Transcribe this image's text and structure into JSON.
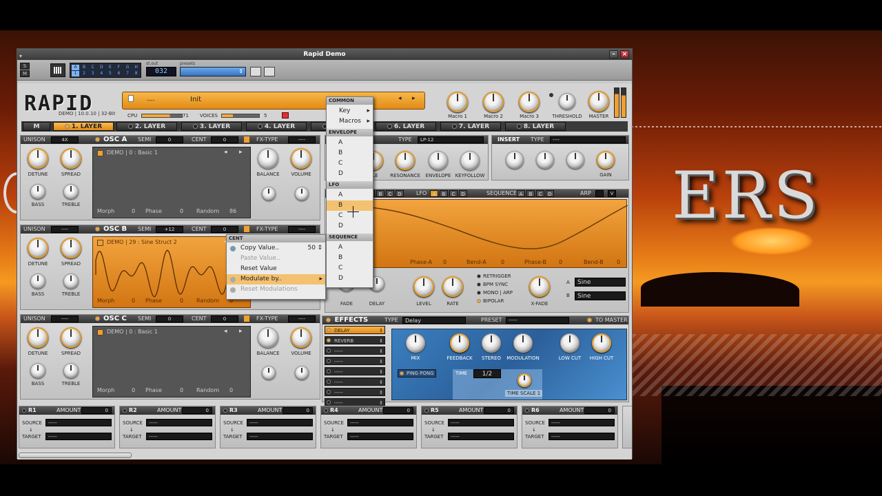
{
  "window": {
    "title": "Rapid Demo",
    "minimize": "–",
    "close": "×"
  },
  "toolbar": {
    "s_btn": "S",
    "m_btn": "M",
    "midi_grid": [
      "A",
      "B",
      "C",
      "D",
      "E",
      "F",
      "G",
      "H",
      "1",
      "2",
      "3",
      "4",
      "5",
      "6",
      "7",
      "8"
    ],
    "output_label": "st.out",
    "output_value": "032",
    "preset_label": "presets"
  },
  "header": {
    "logo": "RAPID",
    "version": "DEMO | 10.0.10 | 32-Bit",
    "preset_name": "Init",
    "preset_dash": "----",
    "cpu_label": "CPU",
    "cpu_value": "71",
    "voices_label": "VOICES",
    "voices_value": "5",
    "macros": [
      "Macro 1",
      "Macro 2",
      "Macro 3"
    ],
    "threshold": "THRESHOLD",
    "master": "MASTER"
  },
  "layers": [
    "M",
    "1. LAYER",
    "2. LAYER",
    "3. LAYER",
    "4. LAYER",
    "5. LAYER",
    "6. LAYER",
    "7. LAYER",
    "8. LAYER"
  ],
  "osc": [
    {
      "name": "OSC A",
      "unison": "UNISON",
      "unison_val": "4X",
      "semi": "SEMI",
      "semi_val": "0",
      "cent": "CENT",
      "cent_val": "0",
      "fx": "FX-TYPE",
      "fx_val": "----",
      "wave_title": "DEMO | 0 : Basic 1",
      "morph": "Morph",
      "morph_val": "0",
      "phase": "Phase",
      "phase_val": "0",
      "random": "Random",
      "random_val": "86"
    },
    {
      "name": "OSC B",
      "unison": "UNISON",
      "unison_val": "----",
      "semi": "SEMI",
      "semi_val": "+12",
      "cent": "CENT",
      "cent_val": "0",
      "fx": "FX-TYPE",
      "fx_val": "----",
      "wave_title": "DEMO | 29 : Sine Struct 2",
      "morph": "Morph",
      "morph_val": "0",
      "phase": "Phase",
      "phase_val": "0",
      "random": "Random",
      "random_val": "0"
    },
    {
      "name": "OSC C",
      "unison": "UNISON",
      "unison_val": "----",
      "semi": "SEMI",
      "semi_val": "0",
      "cent": "CENT",
      "cent_val": "0",
      "fx": "FX-TYPE",
      "fx_val": "----",
      "wave_title": "DEMO | 0 : Basic 1",
      "morph": "Morph",
      "morph_val": "0",
      "phase": "Phase",
      "phase_val": "0",
      "random": "Random",
      "random_val": "0"
    }
  ],
  "osc_knobs": {
    "detune": "DETUNE",
    "spread": "SPREAD",
    "bass": "BASS",
    "treble": "TREBLE",
    "balance": "BALANCE",
    "volume": "VOLUME"
  },
  "filter": {
    "type_label": "TYPE",
    "type_val": "LP-12",
    "knobs": [
      "RESONANCE",
      "ENVELOPE",
      "KEYFOLLOW"
    ],
    "partial": "BLE"
  },
  "insert": {
    "title": "INSERT",
    "type_label": "TYPE",
    "type_val": "----",
    "gain": "GAIN"
  },
  "lfo": {
    "label": "LFO",
    "buttons": [
      "A",
      "B",
      "C",
      "D"
    ],
    "sequence": "SEQUENCE",
    "arp": "ARP",
    "arp_v": "V",
    "phase_a": "Phase-A",
    "phase_a_val": "0",
    "bend_a": "Bend-A",
    "bend_a_val": "0",
    "phase_b": "Phase-B",
    "phase_b_val": "0",
    "bend_b": "Bend-B",
    "bend_b_val": "0",
    "knobs": [
      "FADE",
      "DELAY",
      "LEVEL",
      "RATE",
      "X-FADE"
    ],
    "options": [
      "RETRIGGER",
      "BPM SYNC",
      "MONO | ARP",
      "BIPOLAR"
    ],
    "shape_a": "Sine",
    "shape_b": "Sine",
    "a": "A",
    "b": "B"
  },
  "effects": {
    "title": "EFFECTS",
    "type_label": "TYPE",
    "type_val": "Delay",
    "preset_label": "PRESET",
    "preset_val": "-----",
    "to_master": "TO MASTER",
    "slots": [
      "DELAY",
      "REVERB",
      "-----",
      "-----",
      "-----",
      "-----",
      "-----",
      "-----"
    ],
    "knobs": [
      "MIX",
      "FEEDBACK",
      "STEREO",
      "MODULATION",
      "LOW CUT",
      "HIGH CUT"
    ],
    "ping_pong": "PING PONG",
    "time_label": "TIME",
    "time_val": "1/2",
    "time_scale": "TIME SCALE 1"
  },
  "mod_slots": [
    {
      "name": "R1",
      "amount": "AMOUNT",
      "amount_val": "0",
      "source": "SOURCE",
      "source_val": "-----",
      "target": "TARGET",
      "target_val": "-----"
    },
    {
      "name": "R2",
      "amount": "AMOUNT",
      "amount_val": "0",
      "source": "SOURCE",
      "source_val": "-----",
      "target": "TARGET",
      "target_val": "-----"
    },
    {
      "name": "R3",
      "amount": "AMOUNT",
      "amount_val": "0",
      "source": "SOURCE",
      "source_val": "-----",
      "target": "TARGET",
      "target_val": "-----"
    },
    {
      "name": "R4",
      "amount": "AMOUNT",
      "amount_val": "0",
      "source": "SOURCE",
      "source_val": "-----",
      "target": "TARGET",
      "target_val": "-----"
    },
    {
      "name": "R5",
      "amount": "AMOUNT",
      "amount_val": "0",
      "source": "SOURCE",
      "source_val": "-----",
      "target": "TARGET",
      "target_val": "-----"
    },
    {
      "name": "R6",
      "amount": "AMOUNT",
      "amount_val": "0",
      "source": "SOURCE",
      "source_val": "-----",
      "target": "TARGET",
      "target_val": "-----"
    }
  ],
  "context_menu": {
    "header": "CENT",
    "items": [
      "Copy Value..",
      "Paste Value..",
      "Reset Value",
      "Modulate by..",
      "Reset Modulations"
    ],
    "copy_value_num": "50"
  },
  "submenu": {
    "sections": [
      {
        "title": "COMMON",
        "items": [
          "Key",
          "Macros"
        ]
      },
      {
        "title": "ENVELOPE",
        "items": [
          "A",
          "B",
          "C",
          "D"
        ]
      },
      {
        "title": "LFO",
        "items": [
          "A",
          "B",
          "C",
          "D"
        ]
      },
      {
        "title": "SEQUENCE",
        "items": [
          "A",
          "B",
          "C",
          "D"
        ]
      }
    ]
  },
  "desktop": {
    "logo_text": "ERS"
  },
  "colors": {
    "accent": "#e8921e",
    "panel": "#d4d4d4",
    "dark": "#2d2d2d",
    "fx_blue": "#3f86c4"
  }
}
